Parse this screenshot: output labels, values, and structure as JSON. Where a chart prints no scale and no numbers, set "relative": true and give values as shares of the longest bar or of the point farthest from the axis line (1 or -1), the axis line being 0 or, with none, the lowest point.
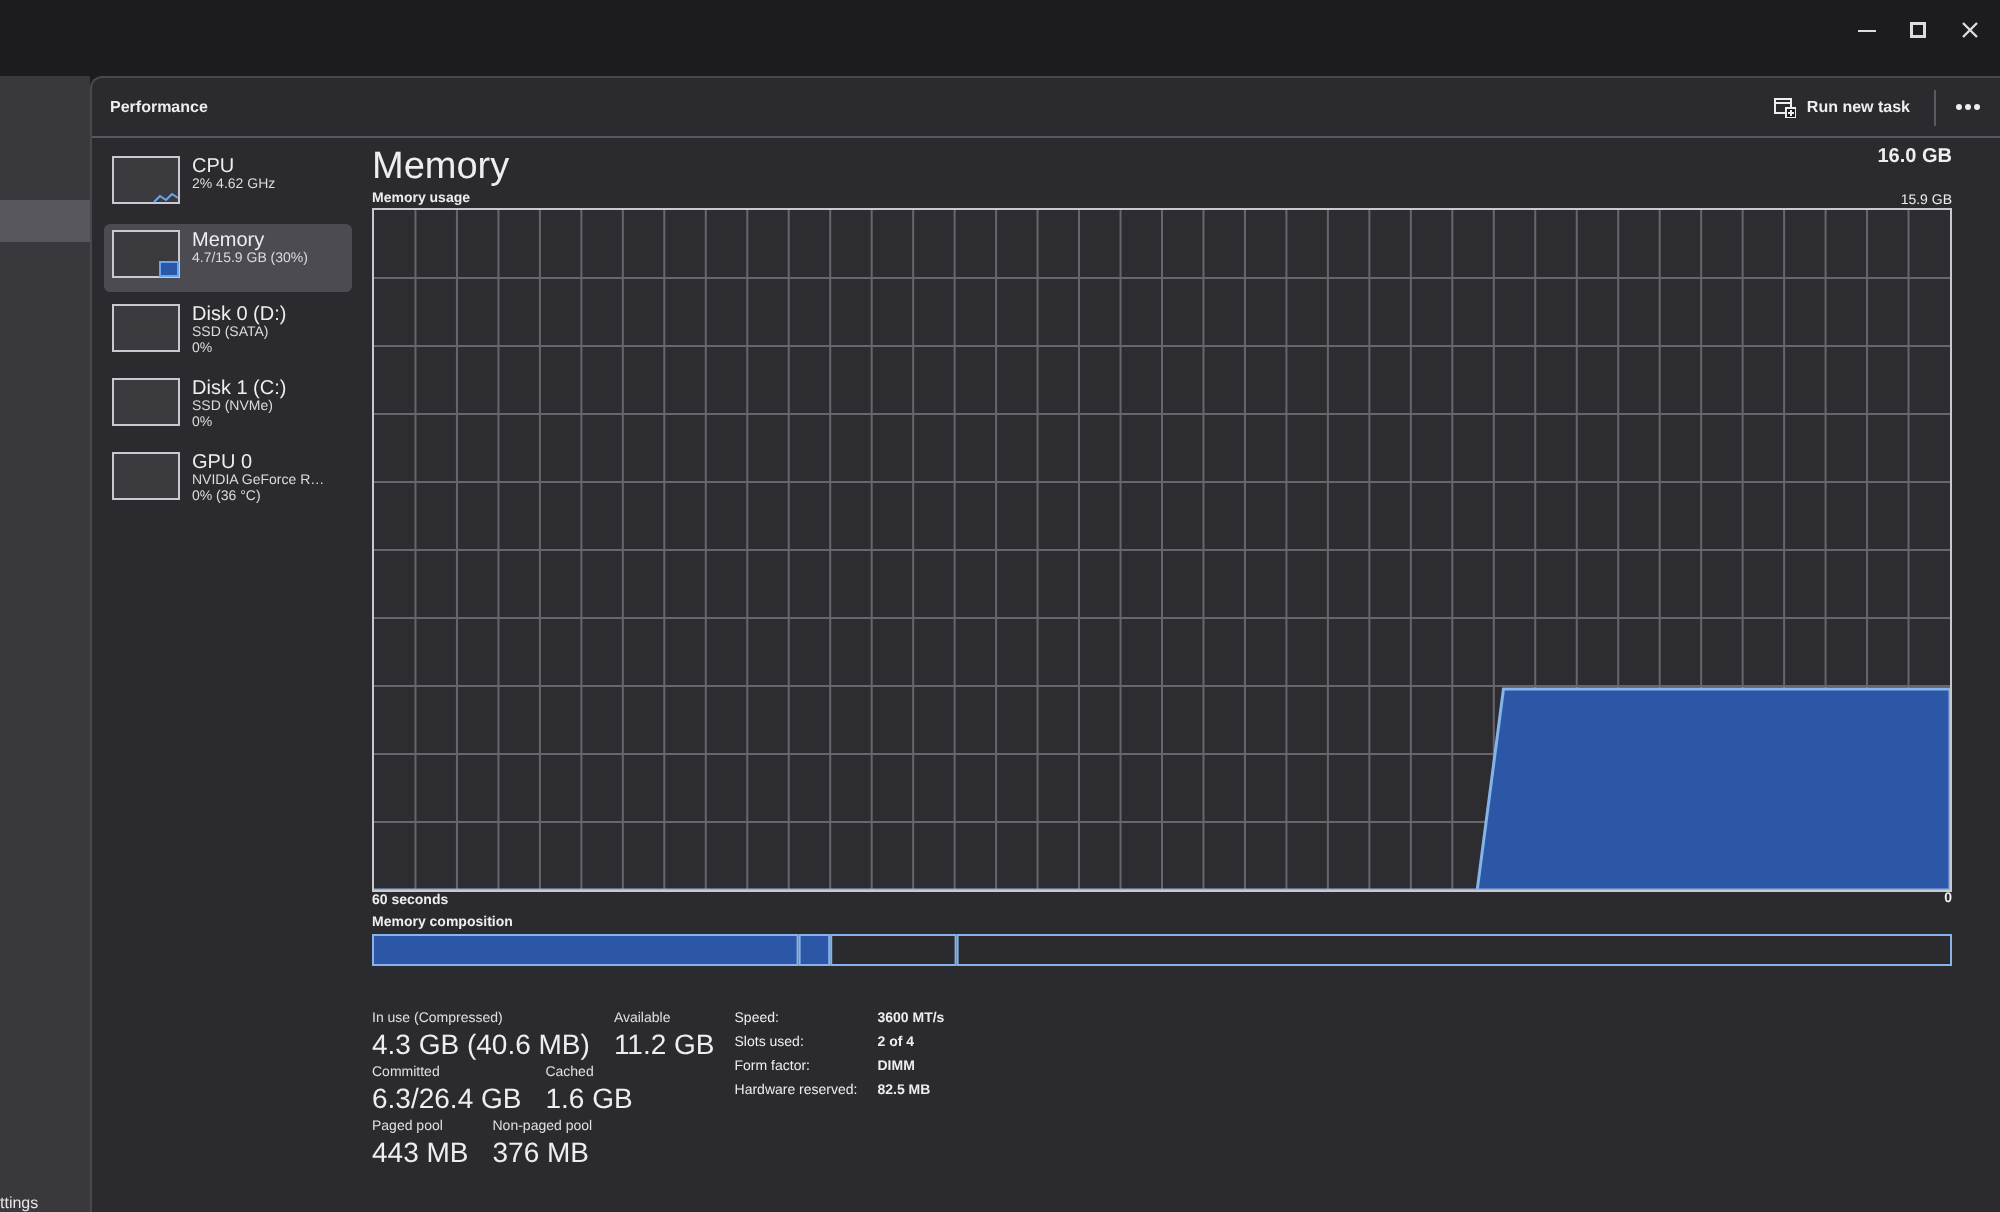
{
  "nav_rail": {
    "items": [
      {
        "selected": true
      }
    ],
    "footer_item": {
      "label": "ttings"
    }
  },
  "header": {
    "title": "Performance",
    "run_new_task": "Run new task"
  },
  "devices": [
    {
      "kind": "cpu",
      "name": "CPU",
      "details": [
        "2% 4.62 GHz"
      ],
      "selected": false
    },
    {
      "kind": "memory",
      "name": "Memory",
      "details": [
        "4.7/15.9 GB (30%)"
      ],
      "selected": true
    },
    {
      "kind": "disk",
      "name": "Disk 0 (D:)",
      "details": [
        "SSD (SATA)",
        "0%"
      ],
      "selected": false
    },
    {
      "kind": "disk",
      "name": "Disk 1 (C:)",
      "details": [
        "SSD (NVMe)",
        "0%"
      ],
      "selected": false
    },
    {
      "kind": "gpu",
      "name": "GPU 0",
      "details": [
        "NVIDIA GeForce R…",
        "0% (36 °C)"
      ],
      "selected": false
    }
  ],
  "memory": {
    "title": "Memory",
    "capacity": "16.0 GB",
    "usage_graph": {
      "chart_data": {
        "type": "area",
        "title": "Memory usage",
        "grid": true,
        "categories": [
          null,
          null,
          null,
          null,
          null,
          null,
          null,
          null,
          null,
          null,
          null,
          null,
          null,
          null,
          null,
          null,
          null,
          null,
          null,
          null,
          null,
          null,
          null,
          null,
          null,
          null,
          null,
          null,
          null,
          null,
          null,
          null,
          null,
          null,
          null,
          null,
          null,
          null,
          null,
          null,
          null,
          null,
          null,
          null,
          null,
          null,
          null,
          null,
          null,
          null,
          null,
          null,
          null,
          null,
          null,
          null,
          null,
          null,
          null,
          null,
          null
        ],
        "series": [
          {
            "color": "#2c57a6",
            "values": [
              0,
              0,
              0,
              0,
              0,
              0,
              0,
              0,
              0,
              0,
              0,
              0,
              0,
              0,
              0,
              0,
              0,
              0,
              0,
              0,
              0,
              0,
              0,
              0,
              0,
              0,
              0,
              0,
              0,
              0,
              0,
              0,
              0,
              0,
              0,
              0,
              0,
              0,
              0,
              0,
              0,
              0,
              0,
              4.7,
              4.7,
              4.7,
              4.7,
              4.7,
              4.7,
              4.7,
              4.7,
              4.7,
              4.7,
              4.7,
              4.7,
              4.7,
              4.7,
              4.7,
              4.7,
              4.7,
              4.7
            ]
          }
        ],
        "ylim": [
          0,
          15.9
        ],
        "yticks": [
          {
            "value": 0,
            "label": "0"
          },
          {
            "value": 15.9,
            "label": "15.9 GB"
          }
        ],
        "annotations": [
          {
            "text": "60 seconds"
          }
        ]
      }
    },
    "composition": {
      "chart_data": {
        "type": "bar",
        "title": "Memory composition",
        "orientation": "horizontal",
        "stacked": true,
        "relative": true,
        "series": [
          {
            "color": "#2c57a6",
            "values": [
              0.27
            ]
          },
          {
            "color": "#2c57a6",
            "values": [
              0.02
            ]
          },
          {
            "color": "#2b2b2f",
            "values": [
              0.08
            ]
          },
          {
            "color": "#2b2b2f",
            "values": [
              0.63
            ]
          }
        ]
      }
    },
    "stats": [
      [
        {
          "label": "In use (Compressed)",
          "value": "4.3 GB (40.6 MB)"
        },
        {
          "label": "Available",
          "value": "11.2 GB"
        }
      ],
      [
        {
          "label": "Committed",
          "value": "6.3/26.4 GB"
        },
        {
          "label": "Cached",
          "value": "1.6 GB"
        }
      ],
      [
        {
          "label": "Paged pool",
          "value": "443 MB"
        },
        {
          "label": "Non-paged pool",
          "value": "376 MB"
        }
      ]
    ],
    "properties": [
      {
        "label": "Speed:",
        "value": "3600 MT/s"
      },
      {
        "label": "Slots used:",
        "value": "2 of 4"
      },
      {
        "label": "Form factor:",
        "value": "DIMM"
      },
      {
        "label": "Hardware reserved:",
        "value": "82.5 MB"
      }
    ]
  }
}
